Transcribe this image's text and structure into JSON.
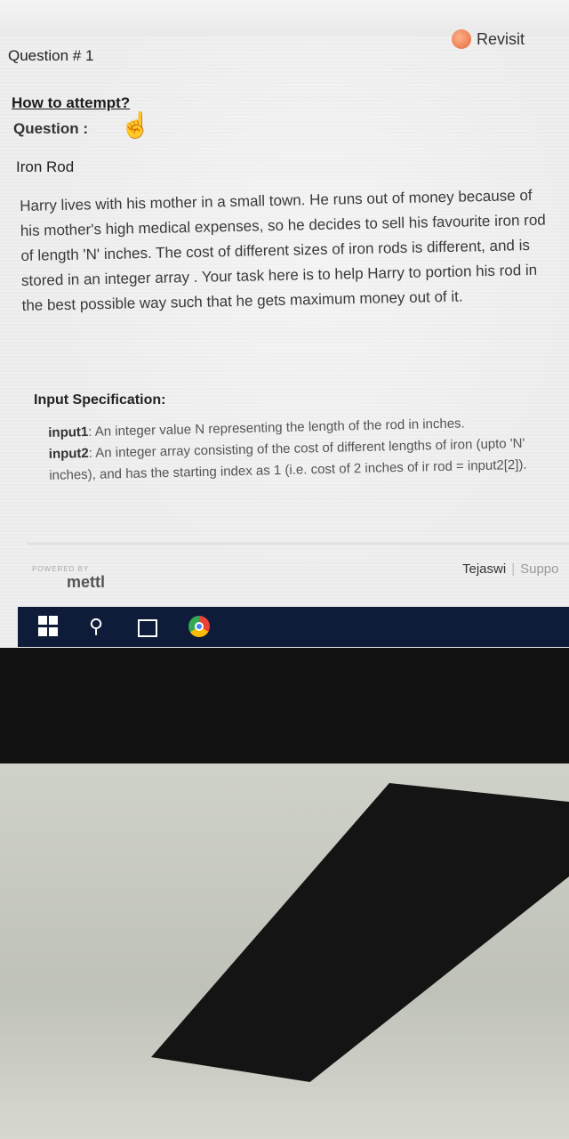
{
  "header": {
    "question_number": "Question # 1",
    "revisit_label": "Revisit"
  },
  "instructions": {
    "how_to_attempt": "How to attempt?",
    "question_label": "Question :"
  },
  "problem": {
    "title": "Iron Rod",
    "description": "Harry lives with his mother in a small town. He runs out of money because of his mother's high medical expenses, so he decides to sell his favourite iron rod of length 'N' inches. The cost of different sizes of iron rods is different, and is stored in an integer array . Your task here is to help Harry to portion his rod in the best possible way such that he gets maximum money out of it.",
    "spec_heading": "Input Specification:",
    "input1_label": "input1",
    "input1_text": ": An integer value N representing the length of the rod in inches.",
    "input2_label": "input2",
    "input2_text": ": An integer array consisting of the cost of different lengths of iron (upto 'N' inches), and has the starting index as 1 (i.e. cost of 2 inches of ir rod = input2[2])."
  },
  "footer": {
    "powered_by": "POWERED BY",
    "brand": "mettl",
    "user_name": "Tejaswi",
    "separator": "|",
    "support_label": "Suppo"
  },
  "taskbar": {
    "icons": [
      "windows-start-icon",
      "search-icon",
      "task-view-icon",
      "chrome-icon"
    ]
  }
}
